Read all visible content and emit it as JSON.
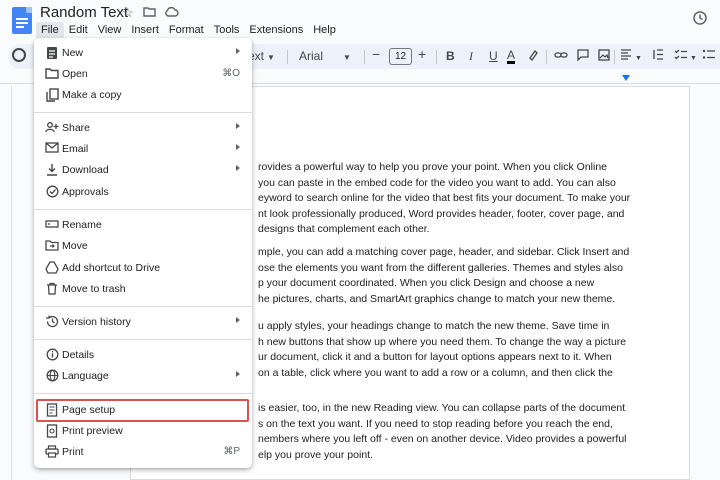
{
  "app": {
    "title": "Random Text",
    "menus": [
      "File",
      "Edit",
      "View",
      "Insert",
      "Format",
      "Tools",
      "Extensions",
      "Help"
    ],
    "active_menu": "File"
  },
  "toolbar": {
    "style_label": "ext",
    "font": "Arial",
    "font_size": "12",
    "minus": "−",
    "plus": "+",
    "bold": "B",
    "italic": "I",
    "underline": "U",
    "text_color": "A"
  },
  "file_menu": {
    "items": [
      {
        "label": "New",
        "icon": "doc-icon",
        "submenu": true
      },
      {
        "label": "Open",
        "icon": "folder-icon",
        "shortcut": "⌘O"
      },
      {
        "label": "Make a copy",
        "icon": "copy-icon"
      },
      {
        "label": "Share",
        "icon": "share-icon",
        "submenu": true
      },
      {
        "label": "Email",
        "icon": "mail-icon",
        "submenu": true
      },
      {
        "label": "Download",
        "icon": "download-icon",
        "submenu": true
      },
      {
        "label": "Approvals",
        "icon": "approval-icon"
      },
      {
        "label": "Rename",
        "icon": "rename-icon"
      },
      {
        "label": "Move",
        "icon": "move-icon"
      },
      {
        "label": "Add shortcut to Drive",
        "icon": "drive-shortcut-icon"
      },
      {
        "label": "Move to trash",
        "icon": "trash-icon"
      },
      {
        "label": "Version history",
        "icon": "history-icon",
        "submenu": true
      },
      {
        "label": "Details",
        "icon": "info-icon"
      },
      {
        "label": "Language",
        "icon": "globe-icon",
        "submenu": true
      },
      {
        "label": "Page setup",
        "icon": "page-setup-icon"
      },
      {
        "label": "Print preview",
        "icon": "print-preview-icon"
      },
      {
        "label": "Print",
        "icon": "print-icon",
        "shortcut": "⌘P"
      }
    ]
  },
  "document": {
    "paragraphs": [
      [
        "rovides a powerful way to help you prove your point. When you click Online",
        "you can paste in the embed code for the video you want to add. You can also",
        "eyword to search online for the video that best fits your document. To make your",
        "nt look professionally produced, Word provides header, footer, cover page, and",
        "designs that complement each other."
      ],
      [
        "mple, you can add a matching cover page, header, and sidebar. Click Insert and",
        "ose the elements you want from the different galleries. Themes and styles also",
        "p your document coordinated. When you click Design and choose a new",
        "he pictures, charts, and SmartArt graphics change to match your new theme."
      ],
      [
        "u apply styles, your headings change to match the new theme. Save time in",
        "h new buttons that show up where you need them. To change the way a picture",
        "ur document, click it and a button for layout options appears next to it. When",
        "on a table, click where you want to add a row or a column, and then click the"
      ],
      [
        "is easier, too, in the new Reading view. You can collapse parts of the document",
        "s on the text you want. If you need to stop reading before you reach the end,",
        "nembers where you left off - even on another device. Video provides a powerful",
        "elp you prove your point."
      ]
    ]
  },
  "colors": {
    "accent": "#1a73e8",
    "highlight_border": "#d9534f"
  }
}
